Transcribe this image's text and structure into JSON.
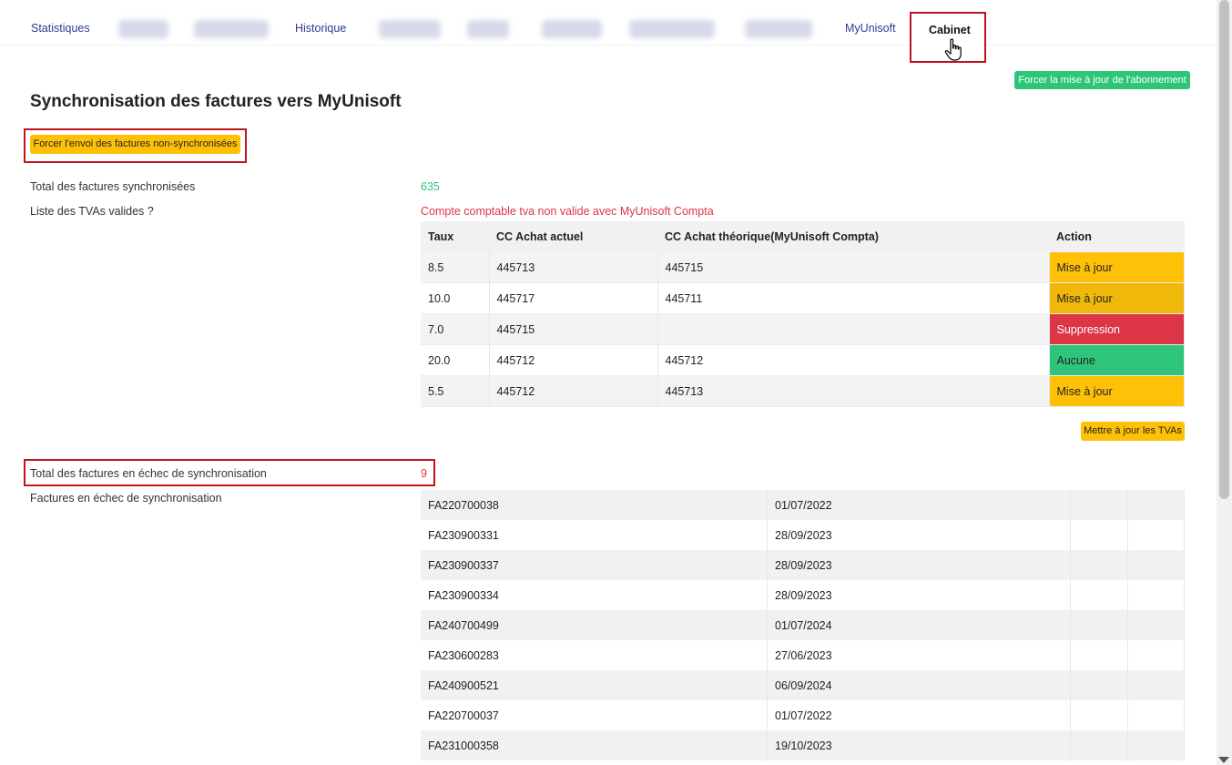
{
  "tabs": {
    "statistiques": "Statistiques",
    "historique": "Historique",
    "myunisoft": "MyUnisoft",
    "cabinet": "Cabinet"
  },
  "buttons": {
    "force_subscription": "Forcer la mise à jour de l'abonnement",
    "force_send": "Forcer l'envoi des factures non-synchronisées",
    "update_tvas": "Mettre à jour les TVAs"
  },
  "page": {
    "title": "Synchronisation des factures vers MyUnisoft"
  },
  "sync": {
    "total_label": "Total des factures synchronisées",
    "total_value": "635",
    "tva_label": "Liste des TVAs valides ?",
    "tva_status": "Compte comptable tva non valide avec MyUnisoft Compta",
    "failed_total_label": "Total des factures en échec de synchronisation",
    "failed_total_value": "9",
    "failed_list_label": "Factures en échec de synchronisation"
  },
  "tva_table": {
    "headers": [
      "Taux",
      "CC Achat actuel",
      "CC Achat théorique(MyUnisoft Compta)",
      "Action"
    ],
    "rows": [
      {
        "taux": "8.5",
        "actuel": "445713",
        "theorique": "445715",
        "action": "Mise à jour"
      },
      {
        "taux": "10.0",
        "actuel": "445717",
        "theorique": "445711",
        "action": "Mise à jour"
      },
      {
        "taux": "7.0",
        "actuel": "445715",
        "theorique": "",
        "action": "Suppression"
      },
      {
        "taux": "20.0",
        "actuel": "445712",
        "theorique": "445712",
        "action": "Aucune"
      },
      {
        "taux": "5.5",
        "actuel": "445712",
        "theorique": "445713",
        "action": "Mise à jour"
      }
    ]
  },
  "failed_invoices": [
    {
      "number": "FA220700038",
      "date": "01/07/2022"
    },
    {
      "number": "FA230900331",
      "date": "28/09/2023"
    },
    {
      "number": "FA230900337",
      "date": "28/09/2023"
    },
    {
      "number": "FA230900334",
      "date": "28/09/2023"
    },
    {
      "number": "FA240700499",
      "date": "01/07/2024"
    },
    {
      "number": "FA230600283",
      "date": "27/06/2023"
    },
    {
      "number": "FA240900521",
      "date": "06/09/2024"
    },
    {
      "number": "FA220700037",
      "date": "01/07/2022"
    },
    {
      "number": "FA231000358",
      "date": "19/10/2023"
    }
  ],
  "colors": {
    "accent_green": "#2ec47a",
    "warning_yellow": "#ffc107",
    "danger_red": "#dc3545",
    "tab_blue": "#2f3b8f",
    "highlight_outline": "#c0121f"
  },
  "icons": {
    "cursor": "hand-pointer-icon"
  }
}
